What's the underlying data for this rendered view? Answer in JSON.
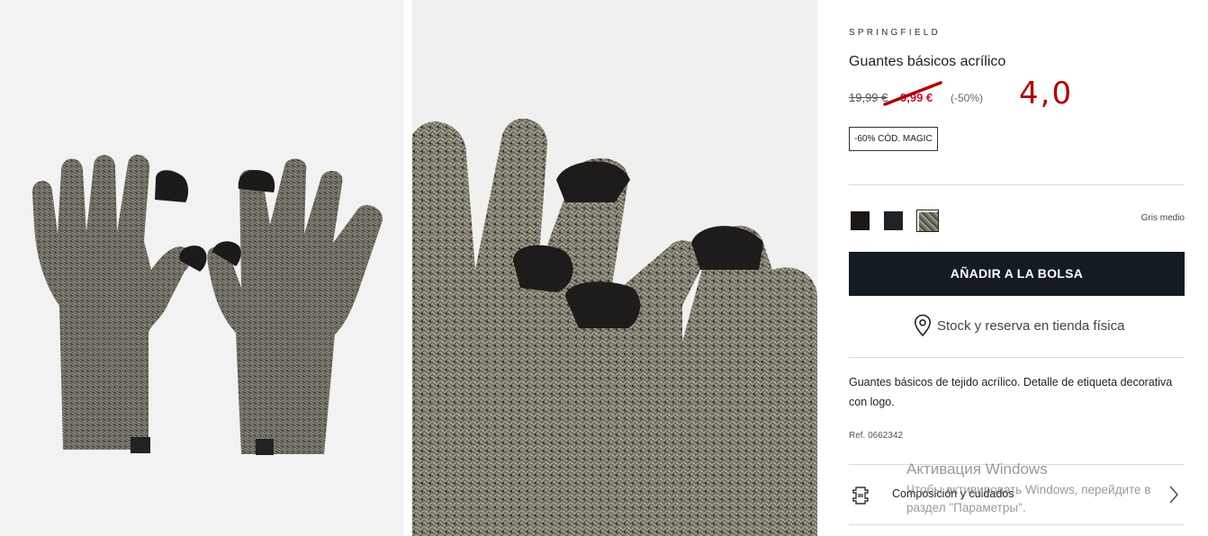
{
  "gallery": {
    "image1_icon": "gloves-pair-photo",
    "image2_icon": "gloves-closeup-photo"
  },
  "product": {
    "brand": "SPRINGFIELD",
    "title": "Guantes básicos acrílico",
    "old_price": "19,99 €",
    "new_price": "9,99 €",
    "discount": "(-50%)",
    "handwritten_note": "4,0",
    "promo_badge": "-60% CÓD. MAGIC",
    "color_label": "Gris medio",
    "swatches": [
      {
        "name": "black",
        "color": "#1b1714"
      },
      {
        "name": "charcoal",
        "color": "#1f2326"
      },
      {
        "name": "gris-medio",
        "color": "#6e6d62",
        "selected": true
      }
    ],
    "add_to_bag": "AÑADIR A LA BOLSA",
    "stock": "Stock y reserva en tienda física",
    "description": "Guantes básicos de tejido acrílico. Detalle de etiqueta decorativa con logo.",
    "ref": "Ref. 0662342",
    "composition": "Composición y cuidados"
  },
  "windows_activation": {
    "title": "Активация Windows",
    "line1": "Чтобы активировать Windows, перейдите в",
    "line2": "раздел \"Параметры\"."
  },
  "colors": {
    "accent_price": "#c8102e",
    "button_bg": "#141b22",
    "annotation_red": "#b00000"
  }
}
